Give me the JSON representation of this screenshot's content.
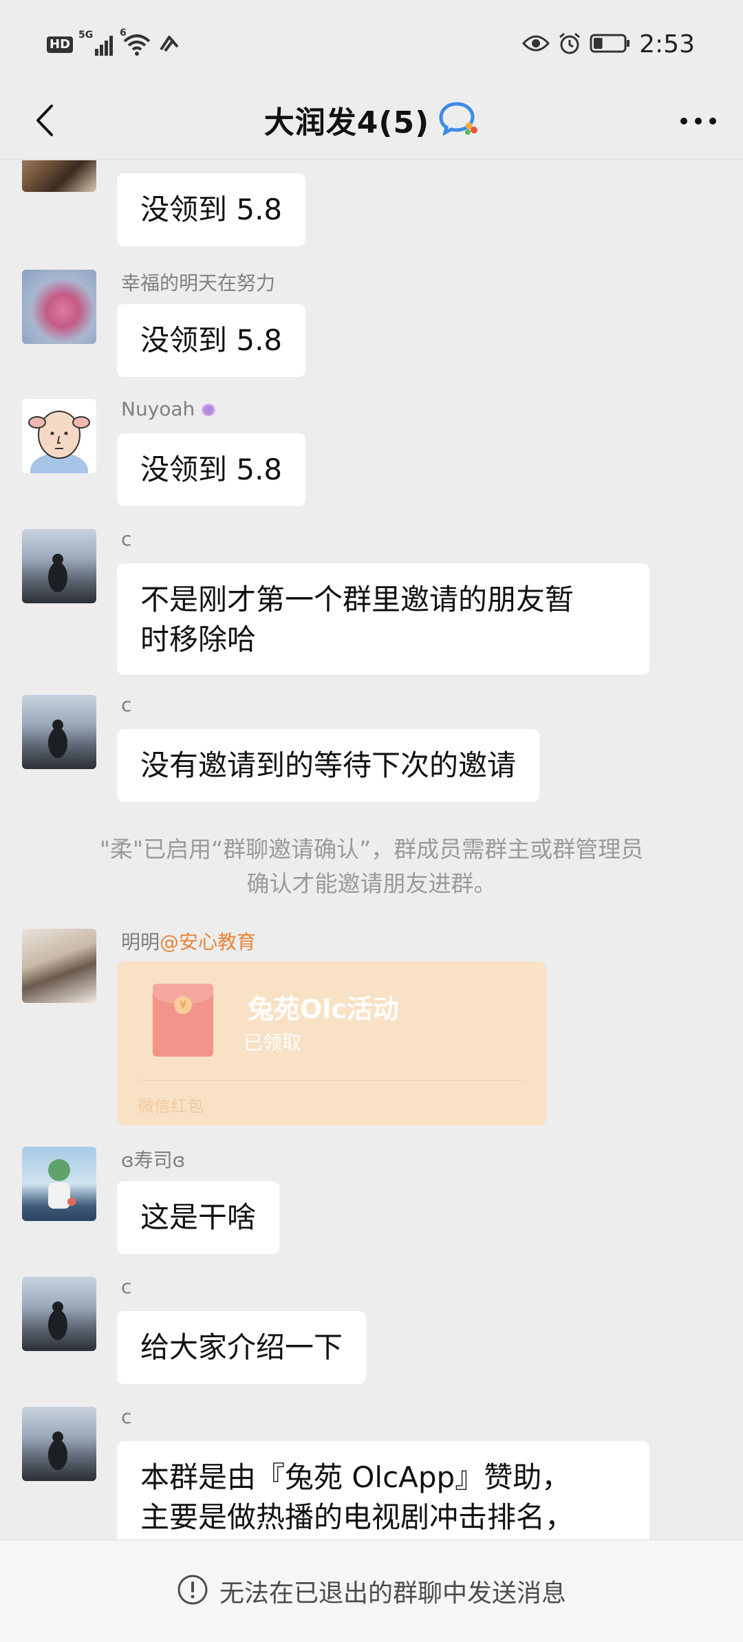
{
  "status_bar": {
    "hd": "HD",
    "network": "5G",
    "wifi_badge": "6",
    "time": "2:53",
    "left_icons": [
      "hd-badge",
      "cellular-signal-icon",
      "wifi-icon",
      "nfc-icon"
    ],
    "right_icons": [
      "eye-icon",
      "alarm-icon",
      "battery-icon"
    ],
    "battery_level": 0.3
  },
  "nav": {
    "title": "大润发4(5)",
    "back_icon": "chevron-left-icon",
    "title_icon": "enterprise-chat-icon",
    "more_icon": "more-dots-icon"
  },
  "messages": [
    {
      "sender": "",
      "text": "没领到 5.8"
    },
    {
      "sender": "幸福的明天在努力",
      "text": "没领到 5.8"
    },
    {
      "sender": "Nuyoah",
      "text": "没领到 5.8"
    },
    {
      "sender": "c",
      "lines": [
        "不是刚才第一个群里邀请的朋友暂",
        "时移除哈"
      ]
    },
    {
      "sender": "c",
      "text": "没有邀请到的等待下次的邀请"
    }
  ],
  "system_note": {
    "lines": [
      "\"柔\"已启用“群聊邀请确认”，群成员需群主或群管理员",
      "确认才能邀请朋友进群。"
    ]
  },
  "red_packet_message": {
    "sender": "明明",
    "mention": "@安心教育",
    "title": "兔苑Olc活动",
    "status": "已领取",
    "label": "微信红包",
    "icon": "red-envelope-icon"
  },
  "messages_after": [
    {
      "sender": "ɞ寿司ɞ",
      "text": "这是干啥"
    },
    {
      "sender": "c",
      "text": "给大家介绍一下"
    },
    {
      "sender": "c",
      "lines": [
        "本群是由『兔苑 OlcApp』赞助，",
        "主要是做热播的电视剧冲击排名，"
      ]
    }
  ],
  "bottom_bar": {
    "icon": "exclamation-circle-icon",
    "text": "无法在已退出的群聊中发送消息"
  },
  "colors": {
    "background": "#ededed",
    "bubble": "#ffffff",
    "mention": "#e8843a",
    "red_packet": "#f8e1c4"
  }
}
